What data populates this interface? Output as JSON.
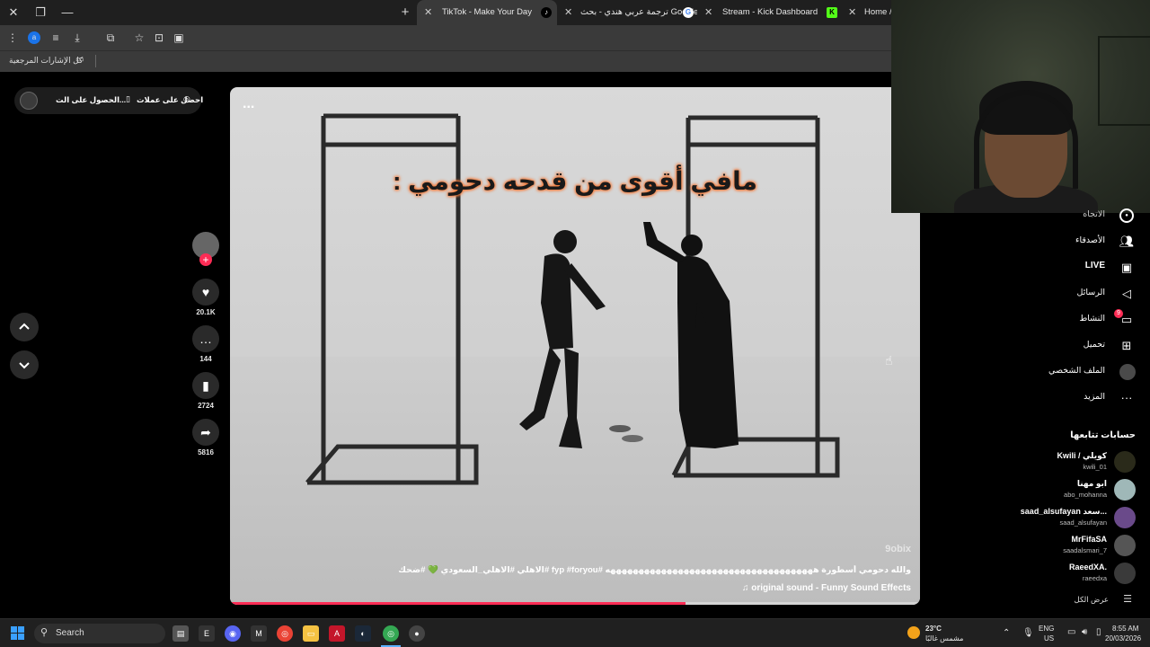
{
  "browser": {
    "tabs": [
      {
        "title": "TikTok - Make Your Day",
        "active": true
      },
      {
        "title": "ترجمة عربي هندي - بحث Google",
        "active": false
      },
      {
        "title": "Stream - Kick Dashboard",
        "active": false
      },
      {
        "title": "Home / X",
        "active": false
      }
    ],
    "window_controls": {
      "close": "✕",
      "restore": "❐",
      "minimize": "—"
    },
    "new_tab": "+",
    "bookmarks_bar_label": "كل الإشارات المرجعية"
  },
  "top_pill": {
    "get_coins": "احصل على عملات",
    "get_app": "الحصول على الت..."
  },
  "video": {
    "more": "...",
    "caption": "مافي أقوى من قدحه دحومي :",
    "watermark": "9obix",
    "description": "والله دحومي أسطورة هههههههههههههههههههههههههههههههههههههه #fyp #foryou #الاهلي #الاهلي_السعودي 💚 #ضحك",
    "sound": "♫ original sound - Funny Sound Effects",
    "progress": 0.66
  },
  "actions": {
    "likes": "20.1K",
    "comments": "144",
    "saves": "2724",
    "shares": "5816"
  },
  "sidebar": {
    "items": [
      {
        "label": "الأصدقاء",
        "icon": "friends-icon"
      },
      {
        "label": "LIVE",
        "icon": "live-icon"
      },
      {
        "label": "الرسائل",
        "icon": "messages-icon"
      },
      {
        "label": "النشاط",
        "icon": "activity-icon",
        "badge": "9"
      },
      {
        "label": "تحميل",
        "icon": "upload-icon"
      },
      {
        "label": "الملف الشخصي",
        "icon": "profile-icon"
      },
      {
        "label": "المزيد",
        "icon": "more-icon"
      }
    ],
    "partial_item": "الاتجاه",
    "following_title": "حسابات تتابعها",
    "following": [
      {
        "name": "Kwili / كويلي",
        "handle": "kwili_01"
      },
      {
        "name": "ابو مهنا",
        "handle": "abo_mohanna"
      },
      {
        "name": "saad_alsufayan سعد...",
        "handle": "saad_alsufayan"
      },
      {
        "name": "MrFifaSA",
        "handle": "saadalsmari_7"
      },
      {
        "name": "RaeedXA.",
        "handle": "raeedxa"
      }
    ],
    "see_all": "عرض الكل"
  },
  "taskbar": {
    "search": "Search",
    "weather_temp": "23°C",
    "weather_desc": "مشمس غالبًا",
    "lang_top": "ENG",
    "lang_bottom": "US",
    "time": "8:55 AM",
    "date": "20/03/2026"
  }
}
